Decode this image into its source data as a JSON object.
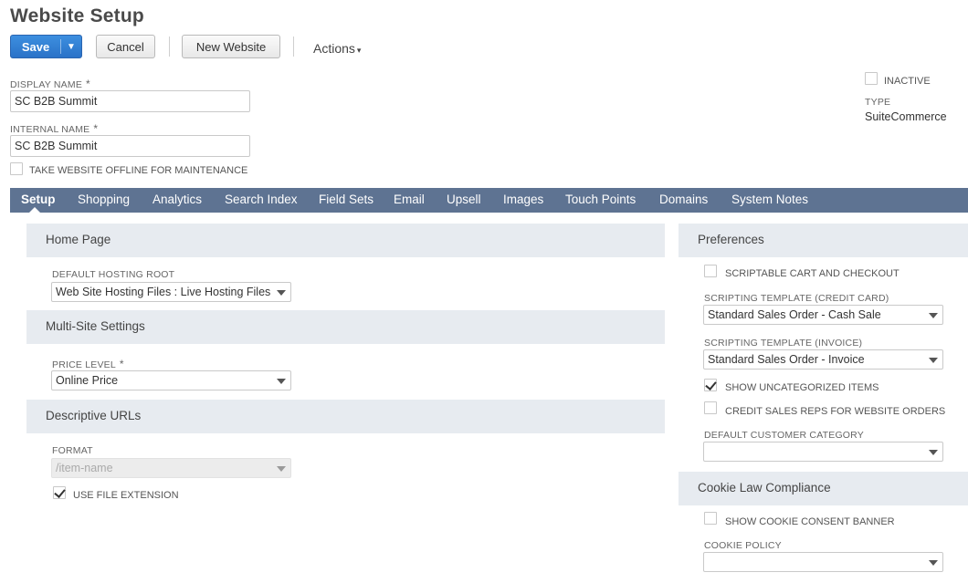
{
  "page": {
    "title": "Website Setup"
  },
  "toolbar": {
    "save_label": "Save",
    "save_dropdown_glyph": "▼",
    "cancel_label": "Cancel",
    "new_website_label": "New Website",
    "actions_label": "Actions",
    "actions_caret": "▾"
  },
  "header_fields": {
    "display_name": {
      "label": "DISPLAY NAME",
      "required_mark": "*",
      "value": "SC B2B Summit"
    },
    "internal_name": {
      "label": "INTERNAL NAME",
      "required_mark": "*",
      "value": "SC B2B Summit"
    },
    "offline": {
      "label": "TAKE WEBSITE OFFLINE FOR MAINTENANCE",
      "checked": false
    },
    "inactive": {
      "label": "INACTIVE",
      "checked": false
    },
    "type": {
      "label": "TYPE",
      "value": "SuiteCommerce"
    }
  },
  "tabs": [
    {
      "label": "Setup",
      "active": true
    },
    {
      "label": "Shopping"
    },
    {
      "label": "Analytics"
    },
    {
      "label": "Search Index"
    },
    {
      "label": "Field Sets"
    },
    {
      "label": "Email"
    },
    {
      "label": "Upsell"
    },
    {
      "label": "Images"
    },
    {
      "label": "Touch Points"
    },
    {
      "label": "Domains"
    },
    {
      "label": "System Notes"
    }
  ],
  "left": {
    "home_page": {
      "header": "Home Page",
      "hosting_root_label": "DEFAULT HOSTING ROOT",
      "hosting_root_value": "Web Site Hosting Files : Live Hosting Files"
    },
    "multi_site": {
      "header": "Multi-Site Settings",
      "price_level_label": "PRICE LEVEL",
      "price_level_required": "*",
      "price_level_value": "Online Price"
    },
    "descriptive_urls": {
      "header": "Descriptive URLs",
      "format_label": "FORMAT",
      "format_value": "/item-name",
      "use_file_ext_label": "USE FILE EXTENSION",
      "use_file_ext_checked": true
    }
  },
  "right": {
    "preferences": {
      "header": "Preferences",
      "scriptable_cart_label": "SCRIPTABLE CART AND CHECKOUT",
      "template_cc_label": "SCRIPTING TEMPLATE (CREDIT CARD)",
      "template_cc_value": "Standard Sales Order - Cash Sale",
      "template_inv_label": "SCRIPTING TEMPLATE (INVOICE)",
      "template_inv_value": "Standard Sales Order - Invoice",
      "show_uncat_label": "SHOW UNCATEGORIZED ITEMS",
      "show_uncat_checked": true,
      "credit_reps_label": "CREDIT SALES REPS FOR WEBSITE ORDERS",
      "default_cust_cat_label": "DEFAULT CUSTOMER CATEGORY",
      "default_cust_cat_value": ""
    },
    "cookie": {
      "header": "Cookie Law Compliance",
      "show_banner_label": "SHOW COOKIE CONSENT BANNER",
      "cookie_policy_label": "COOKIE POLICY",
      "cookie_policy_value": ""
    }
  }
}
